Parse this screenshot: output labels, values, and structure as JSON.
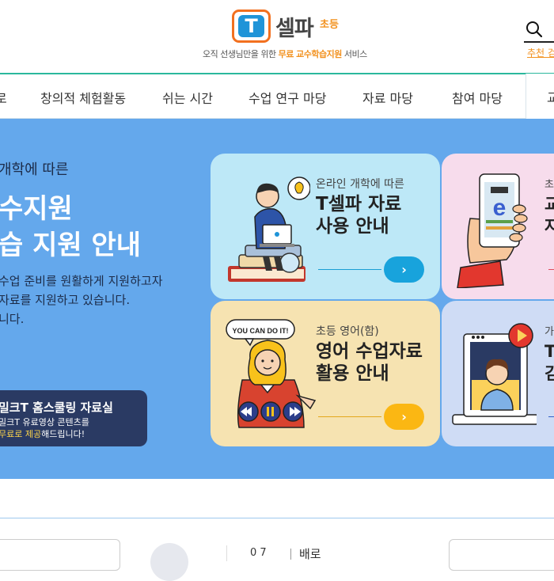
{
  "header": {
    "logo_letter": "T",
    "logo_name": "셀파",
    "logo_sub": "초등",
    "tagline_prefix": "오직 선생님만을 위한 ",
    "tagline_highlight": "무료 교수학습지원",
    "tagline_suffix": " 서비스",
    "keyword_text": "추천 검",
    "search_icon": "search-icon"
  },
  "gnb": {
    "items": [
      "로",
      "창의적 체험활동",
      "쉬는 시간",
      "수업 연구 마당",
      "자료 마당",
      "참여 마당",
      "교"
    ]
  },
  "hero": {
    "subtitle": "개학에 따른",
    "title_line1": "수지원",
    "title_line2": "습 지원 안내",
    "desc_line1": "수업 준비를 원활하게 지원하고자",
    "desc_line2": "자료를 지원하고 있습니다.",
    "desc_line3": "니다.",
    "banner_title": "밀크T 홈스쿨링 자료실",
    "banner_desc1": "밀크T 유료영상 콘텐츠를",
    "banner_desc2_highlight": "무료로 제공",
    "banner_desc2_suffix": "해드립니다!",
    "bg_color": "#64a8ec"
  },
  "cards": [
    {
      "label": "온라인 개학에 따른",
      "title_line1": "T셀파 자료",
      "title_line2": "사용 안내",
      "arrow": "›",
      "color": "#bde8f7"
    },
    {
      "label": "초등 영어(함)",
      "title_line1": "영어 수업자료",
      "title_line2": "활용 안내",
      "arrow": "›",
      "bubble": "YOU CAN DO IT!",
      "color": "#f6e3b1"
    },
    {
      "label": "초",
      "title_line1": "교",
      "title_line2": "자",
      "color": "#f7dcec"
    },
    {
      "label": "가",
      "title_line1": "T",
      "title_line2": "김",
      "color": "#cfdcf5"
    }
  ],
  "bottom": {
    "number": "0 7",
    "text": "배로"
  }
}
